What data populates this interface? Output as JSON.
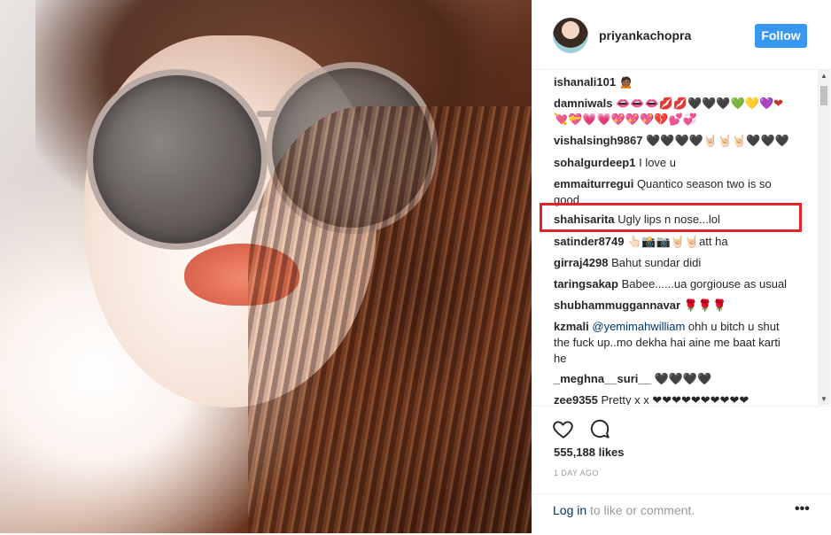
{
  "post": {
    "username": "priyankachopra",
    "follow_label": "Follow",
    "likes": "555,188 likes",
    "timestamp": "1 DAY AGO",
    "login_link": "Log in",
    "login_suffix": " to like or comment.",
    "more_label": "•••"
  },
  "comments": [
    {
      "user": "ishanali101",
      "text": "🙍🏾"
    },
    {
      "user": "damniwals",
      "text": "👄👄👄💋💋🖤🖤🖤💚💛💜❤\n💘💝💗💗💖💖💖💔💕💞"
    },
    {
      "user": "vishalsingh9867",
      "text": "🖤🖤🖤🖤🤘🏻🤘🏻🤘🏻🖤🖤🖤"
    },
    {
      "user": "sohalgurdeep1",
      "text": "I love u"
    },
    {
      "user": "emmaiturregui",
      "text": "Quantico season two is so good"
    },
    {
      "user": "shahisarita",
      "text": "Ugly lips n nose...lol"
    },
    {
      "user": "satinder8749",
      "text": "👆🏻📸📷🤘🏻🤘🏻att ha"
    },
    {
      "user": "girraj4298",
      "text": "Bahut sundar didi"
    },
    {
      "user": "taringsakap",
      "text": "Babee......ua gorgiouse as usual"
    },
    {
      "user": "shubhammuggannavar",
      "text": "🌹🌹🌹"
    },
    {
      "user": "kzmali",
      "mention": "@yemimahwilliam",
      "text": " ohh u bitch u shut the fuck up..mo dekha hai aine me baat karti he"
    },
    {
      "user": "_meghna__suri__",
      "text": "🖤🖤🖤🖤"
    },
    {
      "user": "zee9355",
      "text": "Pretty x x ❤❤❤❤❤❤❤❤❤❤"
    }
  ],
  "colors": {
    "accent": "#3897f0",
    "highlight": "#e3242b",
    "link": "#003569"
  },
  "icons": [
    "heart-icon",
    "comment-icon",
    "more-options-icon"
  ]
}
